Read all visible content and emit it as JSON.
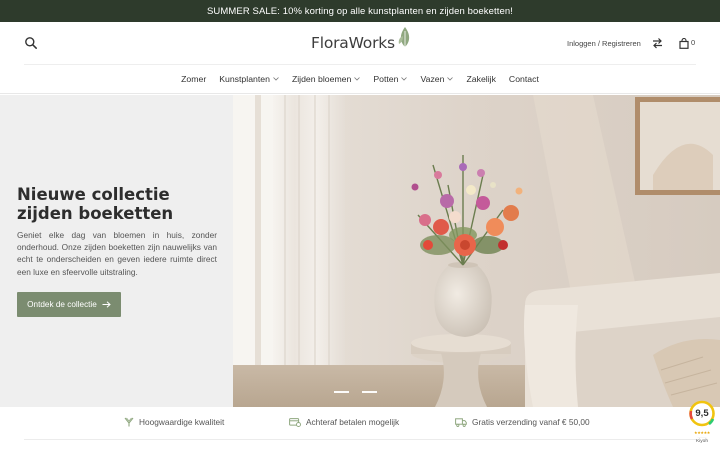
{
  "banner": {
    "text": "SUMMER SALE: 10% korting op alle kunstplanten en zijden boeketten!"
  },
  "header": {
    "logo_text": "FloraWorks",
    "login_label": "Inloggen / Registreren",
    "cart_count": "0",
    "icons": [
      "search-icon",
      "compare-arrows-icon",
      "shopping-bag-icon",
      "leaf-icon"
    ]
  },
  "nav": {
    "items": [
      {
        "label": "Zomer",
        "dropdown": false
      },
      {
        "label": "Kunstplanten",
        "dropdown": true
      },
      {
        "label": "Zijden bloemen",
        "dropdown": true
      },
      {
        "label": "Potten",
        "dropdown": true
      },
      {
        "label": "Vazen",
        "dropdown": true
      },
      {
        "label": "Zakelijk",
        "dropdown": false
      },
      {
        "label": "Contact",
        "dropdown": false
      }
    ]
  },
  "hero": {
    "title": "Nieuwe collectie zijden boeketten",
    "text": "Geniet elke dag van bloemen in huis, zonder onderhoud. Onze zijden boeketten zijn nauwelijks van echt te onderscheiden en geven iedere ruimte direct een luxe en sfeervolle uitstraling.",
    "cta_label": "Ontdek de collectie",
    "slides": 2
  },
  "usp": {
    "items": [
      {
        "label": "Hoogwaardige kwaliteit",
        "icon": "quality-icon"
      },
      {
        "label": "Achteraf betalen mogelijk",
        "icon": "payment-icon"
      },
      {
        "label": "Gratis verzending vanaf € 50,00",
        "icon": "truck-icon"
      }
    ]
  },
  "kiyoh": {
    "score": "9,5",
    "name": "Kiyoh"
  },
  "colors": {
    "banner_bg": "#2e3b2c",
    "accent_green": "#7b8c70",
    "hero_panel_bg": "#efefef"
  }
}
